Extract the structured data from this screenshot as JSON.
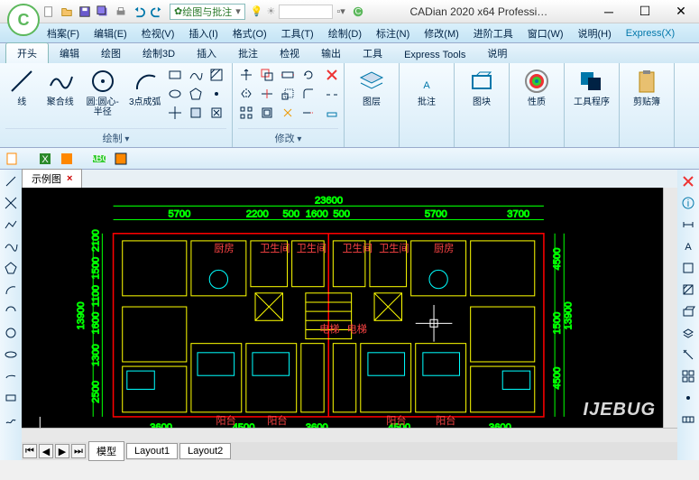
{
  "app": {
    "title": "CADian 2020 x64 Professi…",
    "logo": "C",
    "combo": "绘图与批注"
  },
  "menu": [
    "档案(F)",
    "编辑(E)",
    "检视(V)",
    "插入(I)",
    "格式(O)",
    "工具(T)",
    "绘制(D)",
    "标注(N)",
    "修改(M)",
    "进阶工具",
    "窗口(W)",
    "说明(H)",
    "Express(X)"
  ],
  "tabs": [
    "开头",
    "编辑",
    "绘图",
    "绘制3D",
    "插入",
    "批注",
    "检视",
    "输出",
    "工具",
    "Express Tools",
    "说明"
  ],
  "ribbon": {
    "draw": {
      "label": "绘制",
      "tools": [
        {
          "name": "line-tool",
          "lbl": "线"
        },
        {
          "name": "polyline-tool",
          "lbl": "聚合线"
        },
        {
          "name": "circle-tool",
          "lbl": "圆:圆心-半径"
        },
        {
          "name": "arc-tool",
          "lbl": "3点成弧"
        }
      ]
    },
    "modify": {
      "label": "修改"
    },
    "layer": {
      "lbl": "图层"
    },
    "annot": {
      "lbl": "批注"
    },
    "block": {
      "lbl": "图块"
    },
    "props": {
      "lbl": "性质"
    },
    "util": {
      "lbl": "工具程序"
    },
    "clip": {
      "lbl": "剪贴簿"
    }
  },
  "doc": {
    "tab": "示例图"
  },
  "layout": {
    "tabs": [
      "模型",
      "Layout1",
      "Layout2"
    ]
  },
  "watermark": "IJEBUG"
}
